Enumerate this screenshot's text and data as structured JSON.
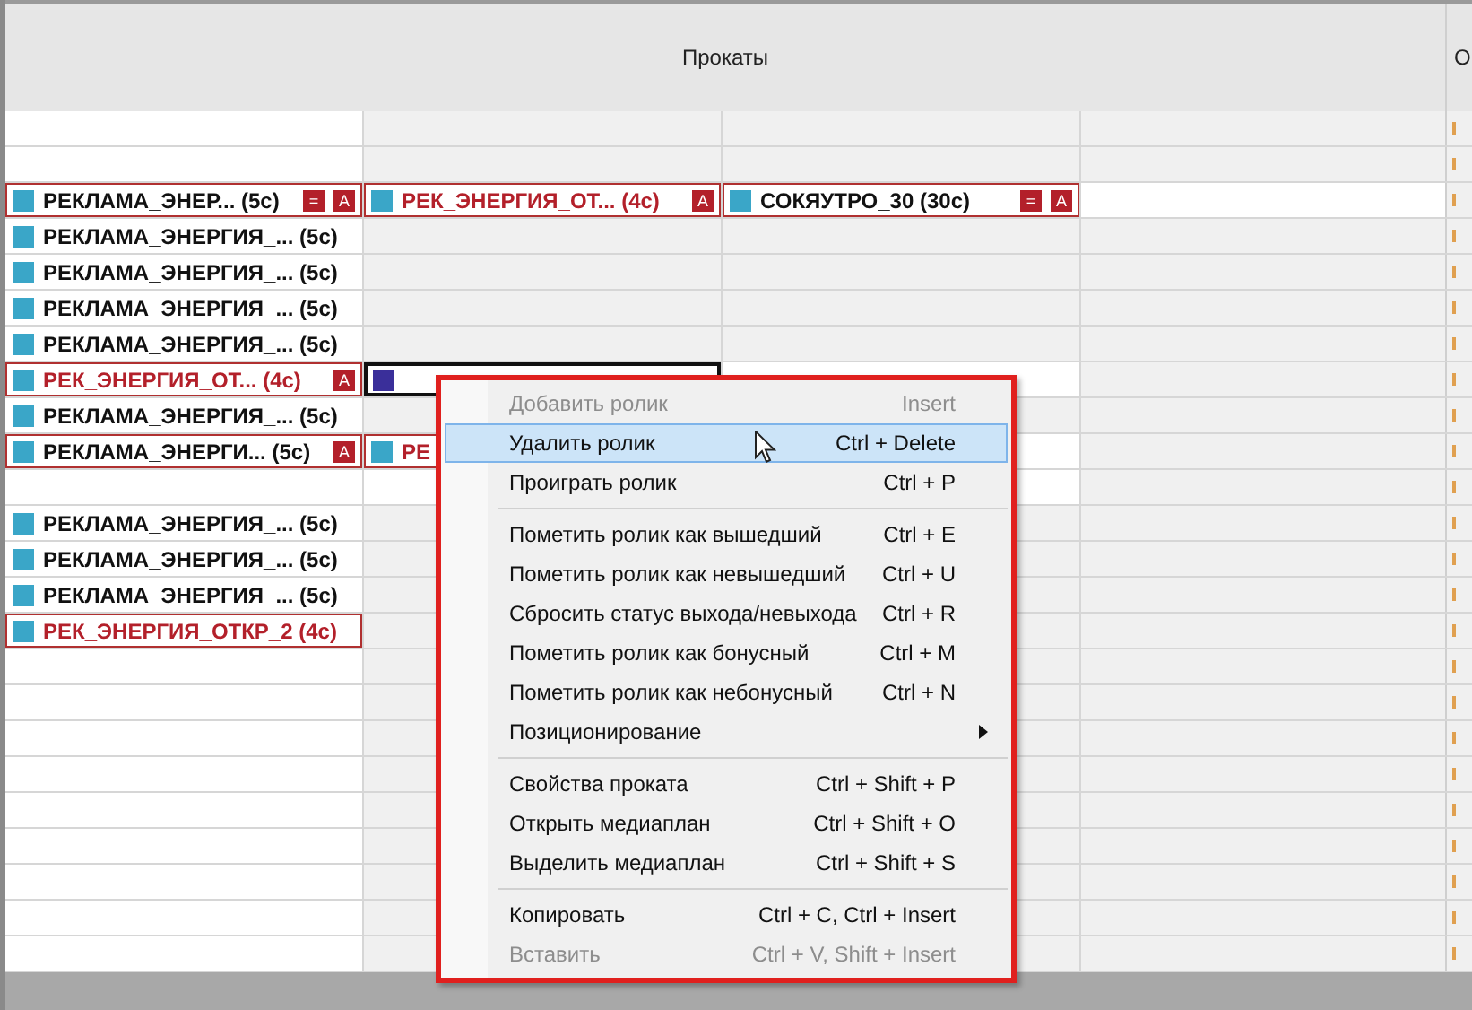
{
  "header": {
    "title": "Прокаты",
    "side_title": "О"
  },
  "rows": [
    {
      "white": false
    },
    {
      "white": false
    },
    {
      "white": true,
      "cells": [
        {
          "label": "РЕКЛАМА_ЭНЕР... (5c)",
          "kind": "normal",
          "bordered": true,
          "selected": false,
          "color": "#3aa6c8",
          "badges": [
            "=",
            "A"
          ]
        },
        {
          "label": "РЕК_ЭНЕРГИЯ_ОТ... (4c)",
          "kind": "red",
          "bordered": true,
          "selected": false,
          "color": "#3aa6c8",
          "badges": [
            "A"
          ]
        },
        {
          "label": "СОКЯУТРО_30 (30c)",
          "kind": "normal",
          "bordered": true,
          "selected": false,
          "color": "#3aa6c8",
          "badges": [
            "=",
            "A"
          ]
        }
      ]
    },
    {
      "white": false,
      "cells": [
        {
          "label": "РЕКЛАМА_ЭНЕРГИЯ_... (5c)",
          "kind": "normal",
          "bordered": false,
          "selected": false,
          "color": "#3aa6c8"
        }
      ]
    },
    {
      "white": false,
      "cells": [
        {
          "label": "РЕКЛАМА_ЭНЕРГИЯ_... (5c)",
          "kind": "normal",
          "bordered": false,
          "selected": false,
          "color": "#3aa6c8"
        }
      ]
    },
    {
      "white": false,
      "cells": [
        {
          "label": "РЕКЛАМА_ЭНЕРГИЯ_... (5c)",
          "kind": "normal",
          "bordered": false,
          "selected": false,
          "color": "#3aa6c8"
        }
      ]
    },
    {
      "white": false,
      "cells": [
        {
          "label": "РЕКЛАМА_ЭНЕРГИЯ_... (5c)",
          "kind": "normal",
          "bordered": false,
          "selected": false,
          "color": "#3aa6c8"
        }
      ]
    },
    {
      "white": true,
      "cells": [
        {
          "label": "РЕК_ЭНЕРГИЯ_ОТ... (4c)",
          "kind": "red",
          "bordered": true,
          "selected": false,
          "color": "#3aa6c8",
          "badges": [
            "A"
          ]
        },
        {
          "bordered": true,
          "selected": true,
          "color": "#3a2f9a"
        }
      ]
    },
    {
      "white": false,
      "cells": [
        {
          "label": "РЕКЛАМА_ЭНЕРГИЯ_... (5c)",
          "kind": "normal",
          "bordered": false,
          "selected": false,
          "color": "#3aa6c8"
        }
      ]
    },
    {
      "white": true,
      "cells": [
        {
          "label": "РЕКЛАМА_ЭНЕРГИ... (5c)",
          "kind": "normal",
          "bordered": true,
          "selected": false,
          "color": "#3aa6c8",
          "badges": [
            "A"
          ]
        },
        {
          "label": "РЕ",
          "kind": "red",
          "bordered": true,
          "selected": false,
          "color": "#3aa6c8"
        }
      ]
    },
    {
      "white": true
    },
    {
      "white": false,
      "cells": [
        {
          "label": "РЕКЛАМА_ЭНЕРГИЯ_... (5c)",
          "kind": "normal",
          "bordered": false,
          "selected": false,
          "color": "#3aa6c8"
        }
      ]
    },
    {
      "white": false,
      "cells": [
        {
          "label": "РЕКЛАМА_ЭНЕРГИЯ_... (5c)",
          "kind": "normal",
          "bordered": false,
          "selected": false,
          "color": "#3aa6c8"
        }
      ]
    },
    {
      "white": false,
      "cells": [
        {
          "label": "РЕКЛАМА_ЭНЕРГИЯ_... (5c)",
          "kind": "normal",
          "bordered": false,
          "selected": false,
          "color": "#3aa6c8"
        }
      ]
    },
    {
      "white": false,
      "cells": [
        {
          "label": "РЕК_ЭНЕРГИЯ_ОТКР_2 (4c)",
          "kind": "red",
          "bordered": true,
          "selected": false,
          "color": "#3aa6c8"
        }
      ]
    },
    {
      "white": false
    },
    {
      "white": false
    },
    {
      "white": false
    },
    {
      "white": false
    },
    {
      "white": false
    },
    {
      "white": false
    },
    {
      "white": false
    },
    {
      "white": false
    },
    {
      "white": false
    }
  ],
  "context_menu": [
    {
      "kind": "item",
      "label": "Добавить ролик",
      "shortcut": "Insert",
      "disabled": true,
      "selected": false
    },
    {
      "kind": "item",
      "label": "Удалить ролик",
      "shortcut": "Ctrl + Delete",
      "disabled": false,
      "selected": true
    },
    {
      "kind": "item",
      "label": "Проиграть ролик",
      "shortcut": "Ctrl + P",
      "disabled": false,
      "selected": false
    },
    {
      "kind": "separator"
    },
    {
      "kind": "item",
      "label": "Пометить ролик как вышедший",
      "shortcut": "Ctrl + E",
      "disabled": false,
      "selected": false
    },
    {
      "kind": "item",
      "label": "Пометить ролик как невышедший",
      "shortcut": "Ctrl + U",
      "disabled": false,
      "selected": false
    },
    {
      "kind": "item",
      "label": "Сбросить статус выхода/невыхода",
      "shortcut": "Ctrl + R",
      "disabled": false,
      "selected": false
    },
    {
      "kind": "item",
      "label": "Пометить ролик как бонусный",
      "shortcut": "Ctrl + M",
      "disabled": false,
      "selected": false
    },
    {
      "kind": "item",
      "label": "Пометить ролик как небонусный",
      "shortcut": "Ctrl + N",
      "disabled": false,
      "selected": false
    },
    {
      "kind": "submenu",
      "label": "Позиционирование",
      "disabled": false,
      "selected": false
    },
    {
      "kind": "separator"
    },
    {
      "kind": "item",
      "label": "Свойства проката",
      "shortcut": "Ctrl + Shift + P",
      "disabled": false,
      "selected": false
    },
    {
      "kind": "item",
      "label": "Открыть медиаплан",
      "shortcut": "Ctrl + Shift + O",
      "disabled": false,
      "selected": false
    },
    {
      "kind": "item",
      "label": "Выделить медиаплан",
      "shortcut": "Ctrl + Shift + S",
      "disabled": false,
      "selected": false
    },
    {
      "kind": "separator"
    },
    {
      "kind": "item",
      "label": "Копировать",
      "shortcut": "Ctrl + C, Ctrl + Insert",
      "disabled": false,
      "selected": false
    },
    {
      "kind": "item",
      "label": "Вставить",
      "shortcut": "Ctrl + V, Shift + Insert",
      "disabled": true,
      "selected": false
    }
  ]
}
